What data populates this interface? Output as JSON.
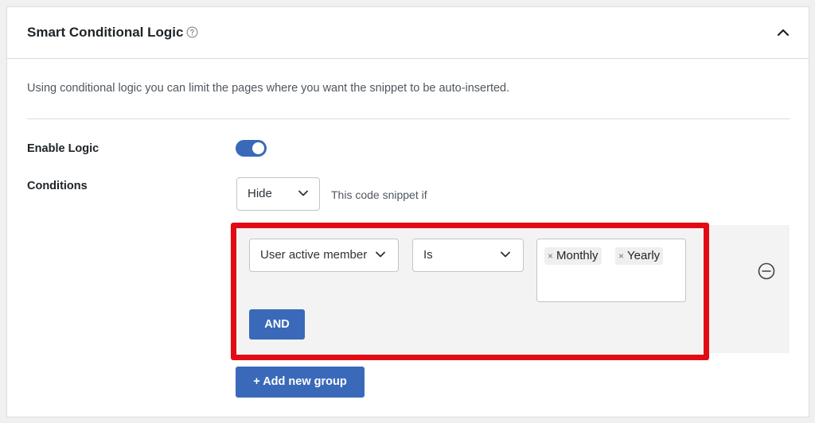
{
  "header": {
    "title": "Smart Conditional Logic"
  },
  "description": "Using conditional logic you can limit the pages where you want the snippet to be auto-inserted.",
  "enable_logic": {
    "label": "Enable Logic",
    "enabled": true
  },
  "conditions": {
    "label": "Conditions",
    "mode_value": "Hide",
    "mode_note": "This code snippet if",
    "group": {
      "field_value": "User active member",
      "operator_value": "Is",
      "tags": [
        "Monthly",
        "Yearly"
      ],
      "and_label": "AND"
    },
    "add_group_label": "+ Add new group"
  },
  "colors": {
    "accent": "#3a69b9",
    "highlight_outline": "#e30b13"
  }
}
